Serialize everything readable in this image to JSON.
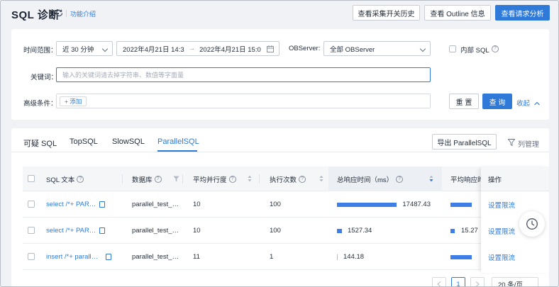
{
  "header": {
    "title": "SQL 诊断",
    "feature_link": "功能介绍",
    "btn_history": "查看采集开关历史",
    "btn_outline": "查看 Outline 信息",
    "btn_analysis": "查看请求分析"
  },
  "filters": {
    "time_range_label": "时间范围：",
    "time_range_value": "近 30 分钟",
    "start_time": "2022年4月21日 14:3",
    "arrow": "→",
    "end_time": "2022年4月21日 15:0",
    "observer_label": "OBServer:",
    "observer_value": "全部 OBServer",
    "internal_sql_label": "内部 SQL",
    "keyword_label": "关键词：",
    "keyword_placeholder": "输入的关键词请去掉字符串、数值等字面量",
    "advanced_label": "高级条件：",
    "add_label": "+ 添加",
    "reset_label": "重 置",
    "query_label": "查 询",
    "collapse_label": "收起"
  },
  "tabs": [
    {
      "label": "可疑 SQL"
    },
    {
      "label": "TopSQL"
    },
    {
      "label": "SlowSQL"
    },
    {
      "label": "ParallelSQL"
    }
  ],
  "export_label": "导出 ParallelSQL",
  "column_manage_label": "列管理",
  "table": {
    "columns": [
      "SQL 文本",
      "数据库",
      "平均并行度",
      "执行次数",
      "总响应时间（ms）",
      "平均响应时",
      "操作"
    ],
    "rows": [
      {
        "sql": "select /*+ PAR…",
        "db": "parallel_test_…",
        "avg_parallel": "10",
        "exec_count": "100",
        "total_ms": "17487.43",
        "total_frac": 1.0,
        "avg_frac": 0.6,
        "avg_ms": "",
        "op": "设置限流"
      },
      {
        "sql": "select /*+ PAR…",
        "db": "parallel_test_…",
        "avg_parallel": "10",
        "exec_count": "100",
        "total_ms": "1527.34",
        "total_frac": 0.087,
        "avg_frac": 0.09,
        "avg_ms": "15.27",
        "op": "设置限流"
      },
      {
        "sql": "insert /*+ parall…",
        "db": "parallel_test_…",
        "avg_parallel": "11",
        "exec_count": "1",
        "total_ms": "144.18",
        "total_frac": 0.008,
        "avg_frac": 0.5,
        "avg_ms": "",
        "op": "设置限流"
      }
    ]
  },
  "pagination": {
    "current_page": "1",
    "page_size": "20 条/页"
  },
  "colors": {
    "accent": "#2f7ad9",
    "bar": "#3d7fe6"
  }
}
